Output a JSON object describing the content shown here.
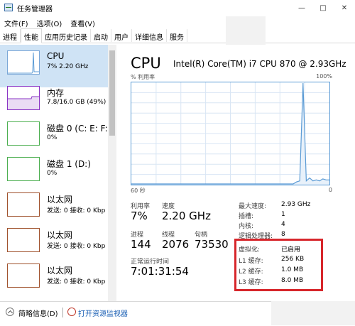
{
  "window": {
    "title": "任务管理器"
  },
  "window_controls": {
    "minimize": "—",
    "maximize": "□",
    "close": "✕"
  },
  "menu": [
    "文件(F)",
    "选项(O)",
    "查看(V)"
  ],
  "tabs": [
    "进程",
    "性能",
    "应用历史记录",
    "启动",
    "用户",
    "详细信息",
    "服务"
  ],
  "active_tab": "性能",
  "sidebar": {
    "items": [
      {
        "title": "CPU",
        "sub": "7% 2.20 GHz",
        "color": "#5b9bd5",
        "selected": true
      },
      {
        "title": "内存",
        "sub": "7.8/16.0 GB (49%)",
        "color": "#8b35c5"
      },
      {
        "title": "磁盘 0 (C: E: F:",
        "sub": "0%",
        "color": "#4caf50"
      },
      {
        "title": "磁盘 1 (D:)",
        "sub": "0%",
        "color": "#4caf50"
      },
      {
        "title": "以太网",
        "sub": "发送: 0 接收: 0 Kbp",
        "color": "#a0522d"
      },
      {
        "title": "以太网",
        "sub": "发送: 0 接收: 0 Kbp",
        "color": "#a0522d"
      },
      {
        "title": "以太网",
        "sub": "发送: 0 接收: 0 Kbp",
        "color": "#a0522d"
      }
    ]
  },
  "cpu": {
    "title": "CPU",
    "model": "Intel(R) Core(TM) i7 CPU 870 @ 2.93GHz",
    "utilization_label": "% 利用率",
    "max_label": "100%",
    "seconds_label": "60 秒",
    "zero_label": "0",
    "graph_values": [
      0,
      0,
      0,
      0,
      0,
      0,
      0,
      0,
      0,
      0,
      0,
      0,
      0,
      0,
      0,
      0,
      0,
      0,
      0,
      0,
      0,
      0,
      0,
      0,
      0,
      0,
      0,
      0,
      0,
      0,
      0,
      0,
      0,
      0,
      0,
      0,
      0,
      0,
      0,
      0,
      0,
      0,
      0,
      0,
      0,
      0,
      0,
      0,
      0,
      0,
      2,
      3,
      100,
      3,
      6,
      3,
      4,
      3,
      5,
      4,
      4
    ]
  },
  "stats": {
    "util_label": "利用率",
    "util_value": "7%",
    "speed_label": "速度",
    "speed_value": "2.20 GHz",
    "proc_label": "进程",
    "proc_value": "144",
    "threads_label": "线程",
    "threads_value": "2076",
    "handles_label": "句柄",
    "handles_value": "73530",
    "uptime_label": "正常运行时间",
    "uptime_value": "7:01:31:54"
  },
  "details": [
    {
      "label": "最大速度:",
      "value": "2.93 GHz"
    },
    {
      "label": "插槽:",
      "value": "1"
    },
    {
      "label": "内核:",
      "value": "4"
    },
    {
      "label": "逻辑处理器:",
      "value": "8"
    },
    {
      "label": "虚拟化:",
      "value": "已启用"
    },
    {
      "label": "L1 缓存:",
      "value": "256 KB"
    },
    {
      "label": "L2 缓存:",
      "value": "1.0 MB"
    },
    {
      "label": "L3 缓存:",
      "value": "8.0 MB"
    }
  ],
  "footer": {
    "less_details": "简略信息(D)",
    "resource_monitor": "打开资源监视器"
  },
  "colors": {
    "graph_line": "#5b9bd5",
    "highlight": "#d7262b",
    "selection": "#cfe3f5"
  }
}
